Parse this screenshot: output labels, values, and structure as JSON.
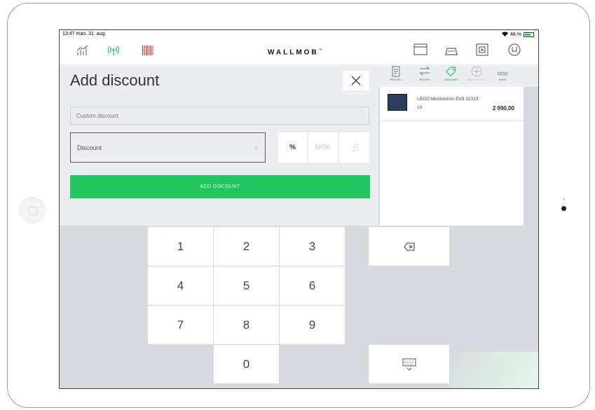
{
  "status_bar": {
    "time": "13:47",
    "date": "man. 31. aug.",
    "battery": "48 %"
  },
  "top_nav": {
    "logo": "WALLMOB",
    "logo_mark": "™"
  },
  "discount_panel": {
    "title": "Add discount",
    "custom_placeholder": "Custom discount",
    "discount_label": "Discount",
    "toggle_percent": "%",
    "toggle_currency": "NOK",
    "add_button": "ADD DISCOUNT"
  },
  "cart_actions": [
    {
      "label": "PRINT BILL"
    },
    {
      "label": "RETURN"
    },
    {
      "label": "DISCOUNT"
    },
    {
      "label": "ADD PRODUCT"
    },
    {
      "label": "MORE"
    }
  ],
  "cart_item": {
    "name": "LEGO Mindstorms EV3 31313",
    "qty": "1X",
    "price": "2 990,00"
  },
  "keypad": {
    "keys": [
      "1",
      "2",
      "3",
      "4",
      "5",
      "6",
      "7",
      "8",
      "9",
      "0"
    ]
  },
  "colors": {
    "accent": "#22c55e",
    "panel": "#ebedf0",
    "keypad_bg": "#d6dade"
  }
}
